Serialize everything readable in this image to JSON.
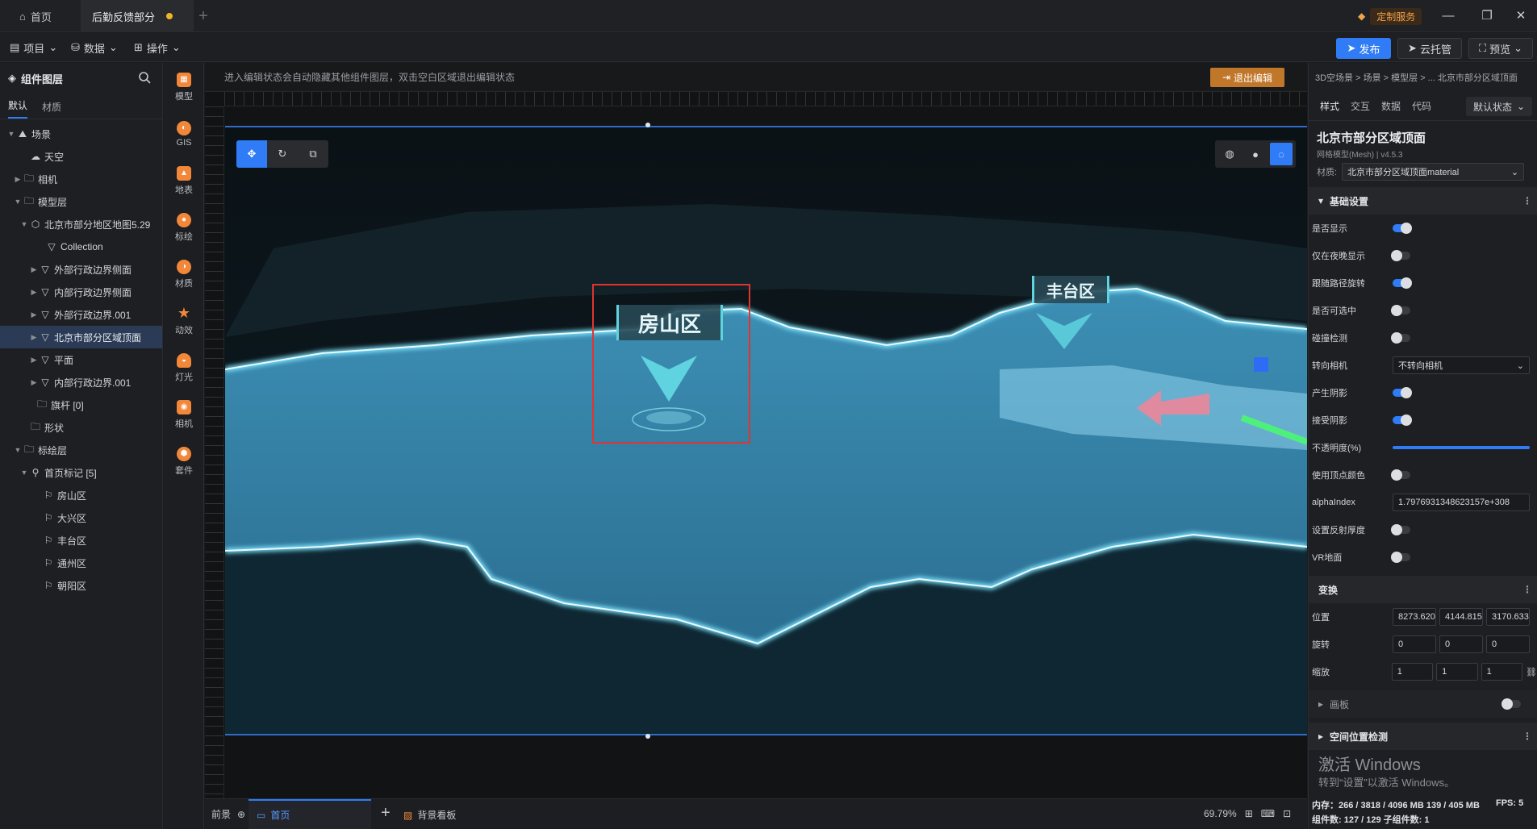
{
  "titlebar": {
    "tabs": [
      {
        "label": "首页"
      },
      {
        "label": "后勤反馈部分"
      }
    ],
    "custom_service": "定制服务",
    "window_buttons": [
      "minimize-icon",
      "restore-icon",
      "close-icon"
    ]
  },
  "menubar": {
    "items": [
      {
        "label": "项目"
      },
      {
        "label": "数据"
      },
      {
        "label": "操作"
      }
    ],
    "publish": "发布",
    "cloud": "云托管",
    "preview": "预览"
  },
  "leftpanel": {
    "title": "组件图层",
    "tabs": [
      "默认",
      "材质"
    ],
    "tree": [
      {
        "label": "场景"
      },
      {
        "label": "天空"
      },
      {
        "label": "相机"
      },
      {
        "label": "模型层"
      },
      {
        "label": "北京市部分地区地图5.29"
      },
      {
        "label": "Collection"
      },
      {
        "label": "外部行政边界侧面"
      },
      {
        "label": "内部行政边界侧面"
      },
      {
        "label": "外部行政边界.001"
      },
      {
        "label": "北京市部分区域顶面"
      },
      {
        "label": "平面"
      },
      {
        "label": "内部行政边界.001"
      },
      {
        "label": "旗杆 [0]"
      },
      {
        "label": "形状"
      },
      {
        "label": "标绘层"
      },
      {
        "label": "首页标记 [5]"
      },
      {
        "label": "房山区"
      },
      {
        "label": "大兴区"
      },
      {
        "label": "丰台区"
      },
      {
        "label": "通州区"
      },
      {
        "label": "朝阳区"
      }
    ]
  },
  "rail": [
    "模型",
    "GIS",
    "地表",
    "标绘",
    "材质",
    "动效",
    "灯光",
    "相机",
    "套件"
  ],
  "canvas": {
    "hint": "进入编辑状态会自动隐藏其他组件图层，双击空白区域退出编辑状态",
    "exit_edit": "退出编辑",
    "labels": {
      "fangshan": "房山区",
      "fengtai": "丰台区"
    },
    "bottom": {
      "front": "前景",
      "home": "首页",
      "bg_board": "背景看板",
      "zoom": "69.79%"
    }
  },
  "rightpanel": {
    "breadcrumb": "3D空场景 > 场景 > 模型层 > ... 北京市部分区域顶面",
    "tabs": [
      "样式",
      "交互",
      "数据",
      "代码"
    ],
    "state": "默认状态",
    "title": "北京市部分区域顶面",
    "subtitle": "网格模型(Mesh) | v4.5.3",
    "material_label": "材质:",
    "material_value": "北京市部分区域顶面material",
    "basic_section": "基础设置",
    "props": {
      "show": "是否显示",
      "night_only": "仅在夜晚显示",
      "follow_path": "跟随路径旋转",
      "selectable": "是否可选中",
      "collision": "碰撞检测",
      "face_camera": "转向相机",
      "face_camera_value": "不转向相机",
      "cast_shadow": "产生阴影",
      "receive_shadow": "接受阴影",
      "opacity": "不透明度(%)",
      "vertex_color": "使用顶点颜色",
      "alpha_index": "alphaIndex",
      "alpha_index_value": "1.7976931348623157e+308",
      "reflect_thickness": "设置反射厚度",
      "vr_ground": "VR地面"
    },
    "transform_section": "变换",
    "position_label": "位置",
    "position": [
      "8273.6201",
      "4144.8154",
      "3170.6335"
    ],
    "rotation_label": "旋转",
    "rotation": [
      "0",
      "0",
      "0"
    ],
    "scale_label": "缩放",
    "scale": [
      "1",
      "1",
      "1"
    ],
    "brush_section": "画板",
    "spatial_section": "空间位置检测",
    "watermark_title": "激活 Windows",
    "watermark_sub": "转到“设置”以激活 Windows。",
    "memory": "内存：266 / 3818 / 4096 MB  139 / 405 MB",
    "fps": "FPS: 5",
    "components": "组件数: 127 / 129  子组件数: 1"
  }
}
